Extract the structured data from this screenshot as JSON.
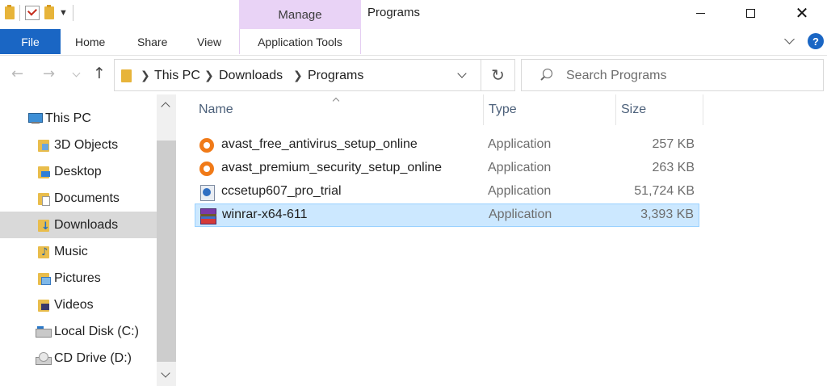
{
  "titlebar": {
    "manage_tab": "Manage",
    "window_title": "Programs"
  },
  "ribbon": {
    "file_label": "File",
    "home_label": "Home",
    "share_label": "Share",
    "view_label": "View",
    "app_tools_label": "Application Tools",
    "help_label": "?"
  },
  "address": {
    "crumbs": [
      "This PC",
      "Downloads",
      "Programs"
    ]
  },
  "search": {
    "placeholder": "Search Programs"
  },
  "navpane": {
    "items": [
      {
        "label": "This PC",
        "icon": "computer-icon"
      },
      {
        "label": "3D Objects",
        "icon": "3d-objects-folder-icon"
      },
      {
        "label": "Desktop",
        "icon": "desktop-folder-icon"
      },
      {
        "label": "Documents",
        "icon": "documents-folder-icon"
      },
      {
        "label": "Downloads",
        "icon": "downloads-folder-icon",
        "selected": true
      },
      {
        "label": "Music",
        "icon": "music-folder-icon"
      },
      {
        "label": "Pictures",
        "icon": "pictures-folder-icon"
      },
      {
        "label": "Videos",
        "icon": "videos-folder-icon"
      },
      {
        "label": "Local Disk (C:)",
        "icon": "local-disk-icon"
      },
      {
        "label": "CD Drive (D:)",
        "icon": "cd-drive-icon"
      }
    ]
  },
  "filelist": {
    "columns": {
      "name": "Name",
      "type": "Type",
      "size": "Size"
    },
    "files": [
      {
        "name": "avast_free_antivirus_setup_online",
        "type": "Application",
        "size": "257 KB",
        "icon": "avast-icon"
      },
      {
        "name": "avast_premium_security_setup_online",
        "type": "Application",
        "size": "263 KB",
        "icon": "avast-icon"
      },
      {
        "name": "ccsetup607_pro_trial",
        "type": "Application",
        "size": "51,724 KB",
        "icon": "ccleaner-setup-icon"
      },
      {
        "name": "winrar-x64-611",
        "type": "Application",
        "size": "3,393 KB",
        "icon": "winrar-icon",
        "selected": true
      }
    ]
  },
  "colors": {
    "accent": "#1a66c4",
    "manage_tab": "#e9d3f6",
    "selection": "#cce8ff",
    "nav_selected": "#d9d9d9"
  }
}
